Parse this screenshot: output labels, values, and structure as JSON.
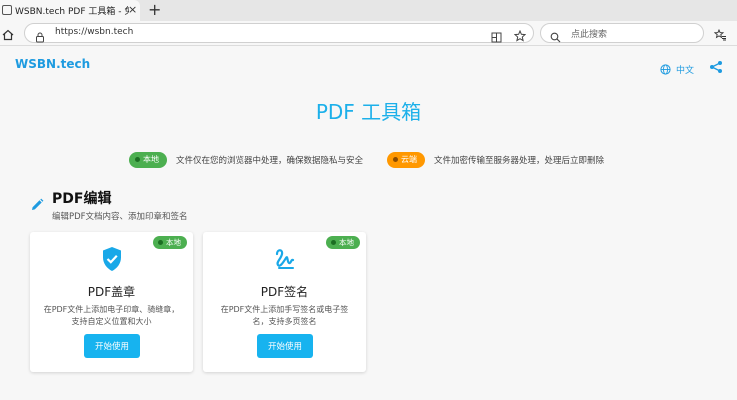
{
  "browser": {
    "tab_title": "WSBN.tech PDF 工具箱 - 免费在线",
    "tab_close": "×",
    "new_tab": "+",
    "url": "https://wsbn.tech",
    "search_placeholder": "点此搜索"
  },
  "header": {
    "brand": "WSBN.tech",
    "language": "中文",
    "icons": [
      "globe-icon",
      "share-icon"
    ]
  },
  "main": {
    "title": "PDF 工具箱",
    "legend": [
      {
        "badge": "本地",
        "description": "文件仅在您的浏览器中处理，确保数据隐私与安全",
        "color": "#4caf50"
      },
      {
        "badge": "云端",
        "description": "文件加密传输至服务器处理，处理后立即删除",
        "color": "#ff9800"
      }
    ],
    "section": {
      "title": "PDF编辑",
      "subtitle": "编辑PDF文档内容、添加印章和签名",
      "icon": "pencil-icon"
    },
    "cards": [
      {
        "badge": "本地",
        "title": "PDF盖章",
        "description": "在PDF文件上添加电子印章、骑缝章，支持自定义位置和大小",
        "button": "开始使用",
        "icon": "shield-check-icon"
      },
      {
        "badge": "本地",
        "title": "PDF签名",
        "description": "在PDF文件上添加手写签名或电子签名，支持多页签名",
        "button": "开始使用",
        "icon": "signature-icon"
      }
    ]
  },
  "colors": {
    "accent": "#1cb0ea",
    "local": "#4caf50",
    "cloud": "#ff9800"
  }
}
